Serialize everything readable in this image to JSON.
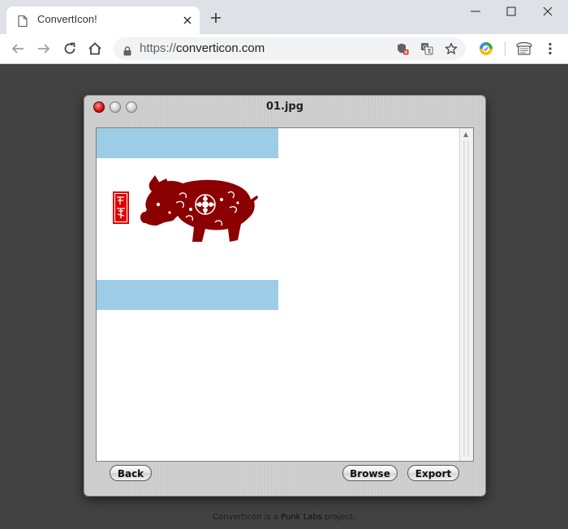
{
  "browser": {
    "tab_title": "ConvertIcon!",
    "url_scheme": "https://",
    "url_host": "converticon.com"
  },
  "app_window": {
    "title": "01.jpg",
    "buttons": {
      "back": "Back",
      "browse": "Browse",
      "export": "Export"
    }
  },
  "image": {
    "band_color": "#9dcce6",
    "motif_color": "#8b0000",
    "seal_color": "#e00000"
  },
  "footer": {
    "prefix": "ConvertIcon is a ",
    "link": "Punk Labs",
    "suffix": " project."
  },
  "colors": {
    "page_background": "#424242",
    "tab_strip": "#dee1e6"
  },
  "icons": [
    "page-icon",
    "close-icon",
    "plus-icon",
    "minimize-icon",
    "maximize-icon",
    "back-arrow-icon",
    "forward-arrow-icon",
    "reload-icon",
    "home-icon",
    "lock-icon",
    "shield-icon",
    "translate-icon",
    "star-icon",
    "chrome-extension-icon",
    "reader-icon",
    "more-icon"
  ]
}
